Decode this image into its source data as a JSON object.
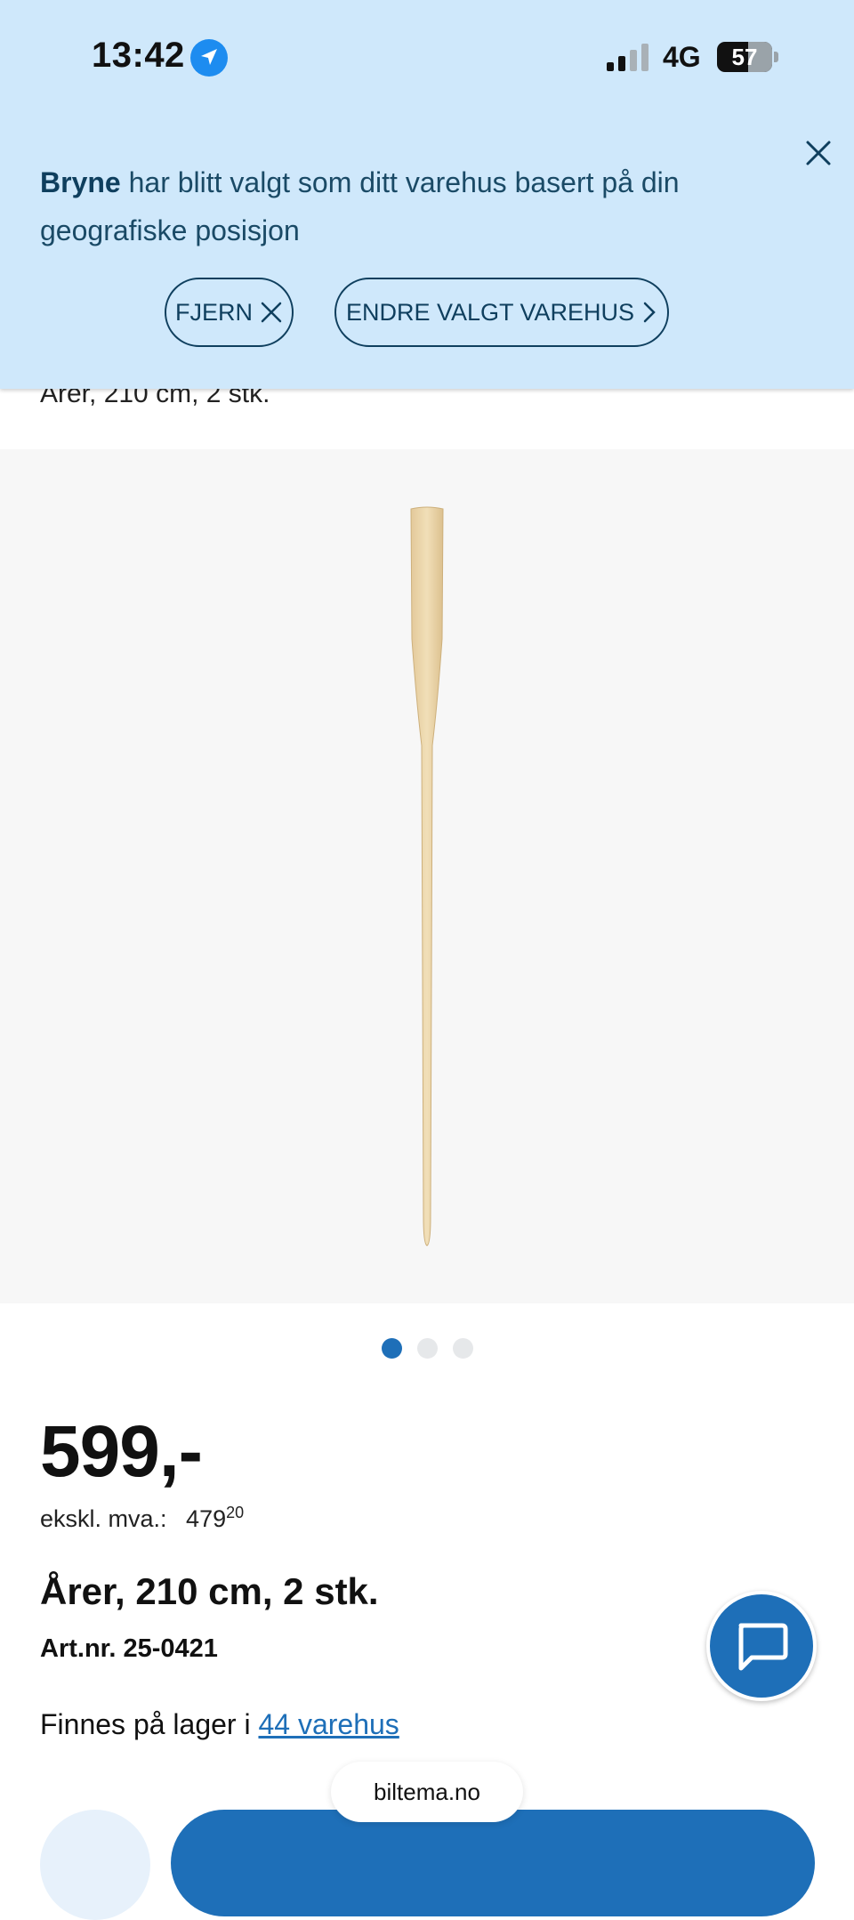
{
  "status_bar": {
    "time": "13:42",
    "network": "4G",
    "battery": "57",
    "battery_level": 0.57
  },
  "notice": {
    "store": "Bryne",
    "message": " har blitt valgt som ditt varehus basert på din geografiske posisjon",
    "remove_label": "FJERN",
    "change_label": "ENDRE VALGT VAREHUS"
  },
  "product": {
    "peek_title": "Årer, 210 cm, 2 stk.",
    "price": "599,-",
    "ex_vat_label": "ekskl. mva.:",
    "ex_vat_value": "479",
    "ex_vat_cents": "20",
    "title": "Årer, 210 cm, 2 stk.",
    "artnr": "Art.nr. 25-0421",
    "stock_prefix": "Finnes på lager i ",
    "stock_link": "44 varehus"
  },
  "gallery": {
    "count": 3,
    "active_index": 0
  },
  "browser": {
    "url": "biltema.no"
  },
  "colors": {
    "accent": "#1e6fb8",
    "banner_bg": "#cfe8fb",
    "banner_text": "#0f3f5e"
  }
}
